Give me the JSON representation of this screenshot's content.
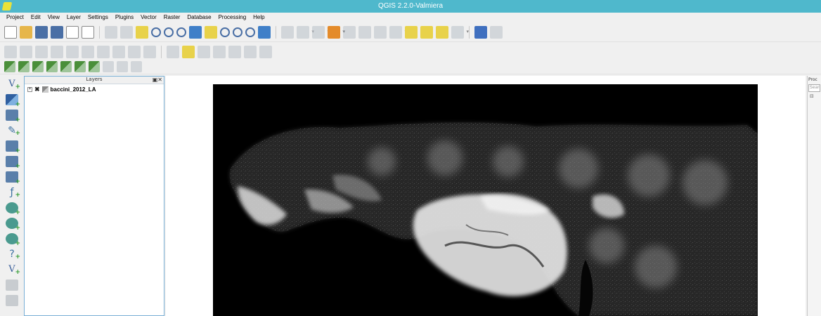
{
  "window": {
    "title": "QGIS 2.2.0-Valmiera"
  },
  "menu": [
    "Project",
    "Edit",
    "View",
    "Layer",
    "Settings",
    "Plugins",
    "Vector",
    "Raster",
    "Database",
    "Processing",
    "Help"
  ],
  "layers_panel": {
    "title": "Layers",
    "layers": [
      {
        "name": "baccini_2012_LA"
      }
    ]
  },
  "processing_panel": {
    "title": "Proc",
    "search_placeholder": "Search"
  }
}
